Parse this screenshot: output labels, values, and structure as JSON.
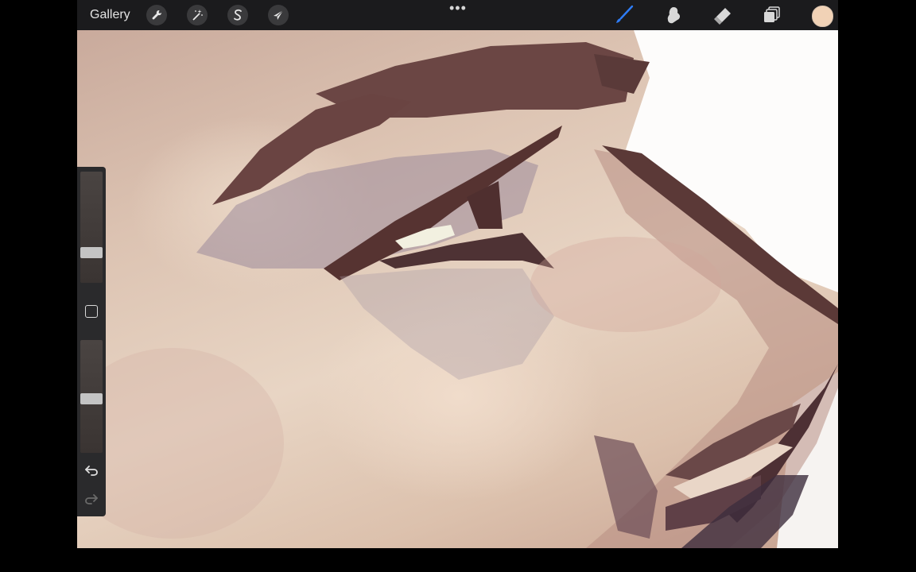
{
  "toolbar": {
    "gallery_label": "Gallery",
    "left_tools": [
      "wrench-icon",
      "magic-wand-icon",
      "s-curve-icon",
      "arrow-cursor-icon"
    ],
    "more_label": "•••",
    "right_tools": [
      "brush-icon",
      "smudge-icon",
      "eraser-icon",
      "layers-icon"
    ],
    "active_tool": "brush-icon",
    "accent_color": "#2e7cf6",
    "current_color": "#f1d2b6"
  },
  "sidebar": {
    "brush_size_level": 0.25,
    "opacity_level": 0.48,
    "undo_icon": "undo-icon",
    "redo_icon": "redo-icon"
  },
  "canvas": {
    "description_tags": [
      "painting",
      "face-closeup"
    ]
  }
}
